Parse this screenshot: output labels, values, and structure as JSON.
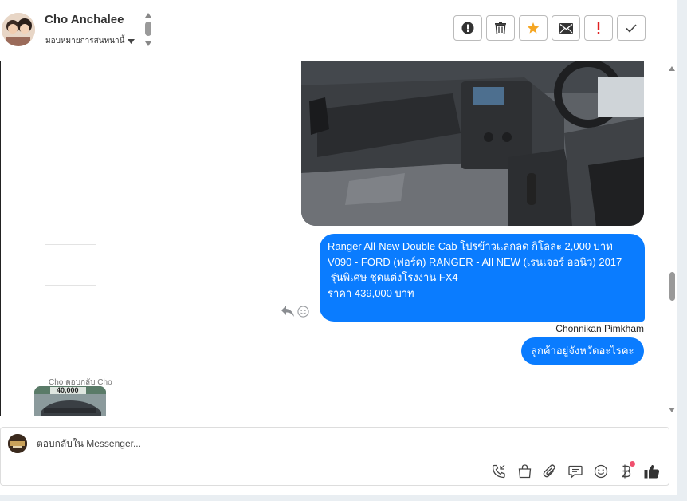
{
  "header": {
    "contact_name": "Cho Anchalee",
    "assign_label": "มอบหมายการสนทนานี้",
    "actions": [
      "alert-icon",
      "trash-icon",
      "star-icon",
      "mail-icon",
      "exclamation-icon",
      "check-icon"
    ]
  },
  "conversation": {
    "message_car": {
      "line1": "Ranger All-New Double Cab โปรข้าวแลกลด กิโลละ 2,000 บาท",
      "line2": "V090 - FORD (ฟอร์ด) RANGER - All NEW (เรนเจอร์ ออนิว) 2017",
      "line3": "",
      "line4": " รุ่นพิเศษ ชุดแต่งโรงงาน FX4",
      "line5": "ราคา 439,000 บาท"
    },
    "sender_name": "Chonnikan Pimkham",
    "message_province": "ลูกค้าอยู่จังหวัดอะไรคะ",
    "reply_label": "Cho ตอบกลับ Cho",
    "thumbnail_price": "40,000"
  },
  "composer": {
    "placeholder": "ตอบกลับใน Messenger...",
    "tools": [
      "call-icon",
      "shop-icon",
      "attach-icon",
      "quick-reply-icon",
      "emoji-icon",
      "baht-icon",
      "like-icon"
    ]
  },
  "colors": {
    "accent": "#0a7cff",
    "star": "#f5a623",
    "alert_red": "#e02020"
  }
}
